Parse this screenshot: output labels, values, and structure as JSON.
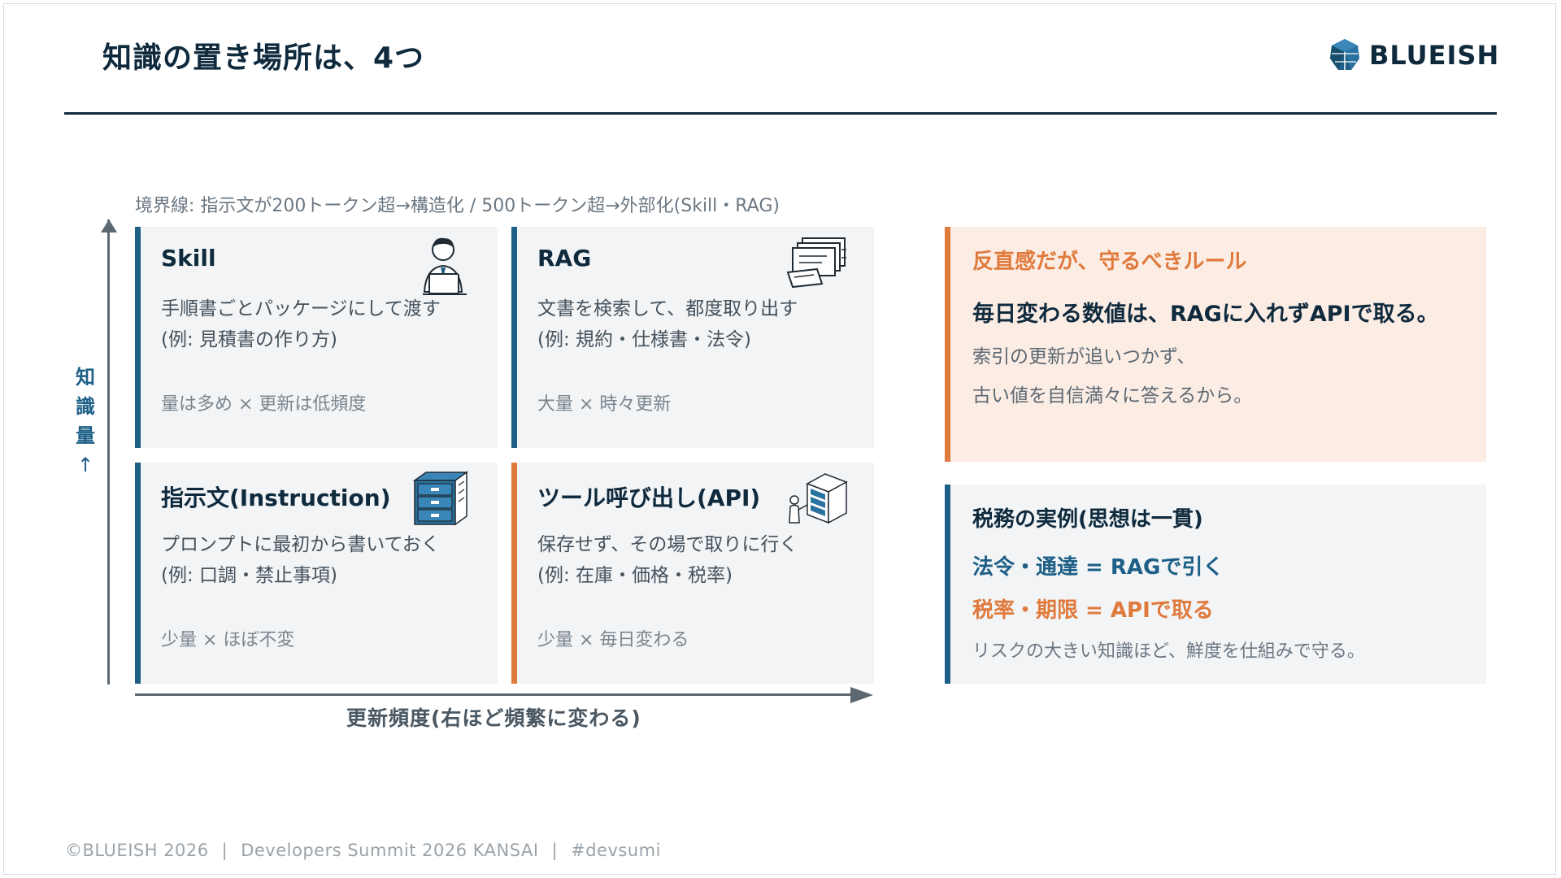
{
  "slide": {
    "title": "知識の置き場所は、4つ",
    "logo_text": "BLUEISH",
    "boundary_note": "境界線: 指示文が200トークン超→構造化 / 500トークン超→外部化(Skill・RAG)"
  },
  "matrix": {
    "y_axis_label": [
      "知",
      "識",
      "量",
      "↑"
    ],
    "x_axis_label": "更新頻度(右ほど頻繁に変わる)",
    "quadrants": [
      {
        "title": "Skill",
        "desc1": "手順書ごとパッケージにして渡す",
        "desc2": "(例: 見積書の作り方)",
        "meta": "量は多め × 更新は低頻度",
        "icon": "person-laptop-icon"
      },
      {
        "title": "RAG",
        "desc1": "文書を検索して、都度取り出す",
        "desc2": "(例: 規約・仕様書・法令)",
        "meta": "大量 × 時々更新",
        "icon": "document-stack-icon"
      },
      {
        "title": "指示文(Instruction)",
        "desc1": "プロンプトに最初から書いておく",
        "desc2": "(例: 口調・禁止事項)",
        "meta": "少量 × ほぼ不変",
        "icon": "file-cabinet-icon"
      },
      {
        "title": "ツール呼び出し(API)",
        "desc1": "保存せず、その場で取りに行く",
        "desc2": "(例: 在庫・価格・税率)",
        "meta": "少量 × 毎日変わる",
        "icon": "server-person-icon"
      }
    ]
  },
  "rule_box": {
    "heading": "反直感だが、守るべきルール",
    "strong": "毎日変わる数値は、RAGに入れずAPIで取る。",
    "line1": "索引の更新が追いつかず、",
    "line2": "古い値を自信満々に答えるから。"
  },
  "tax_box": {
    "heading": "税務の実例(思想は一貫)",
    "blue_line": "法令・通達 = RAGで引く",
    "orange_line": "税率・期限 = APIで取る",
    "note": "リスクの大きい知識ほど、鮮度を仕組みで守る。"
  },
  "footer": {
    "copyright": "©BLUEISH 2026",
    "event": "Developers Summit 2026 KANSAI",
    "hashtag": "#devsumi"
  },
  "colors": {
    "navy": "#0f2a3d",
    "blue": "#1d5f86",
    "orange": "#e07a3c",
    "panel": "#f2f4f6",
    "rule_bg": "#fbece4"
  }
}
